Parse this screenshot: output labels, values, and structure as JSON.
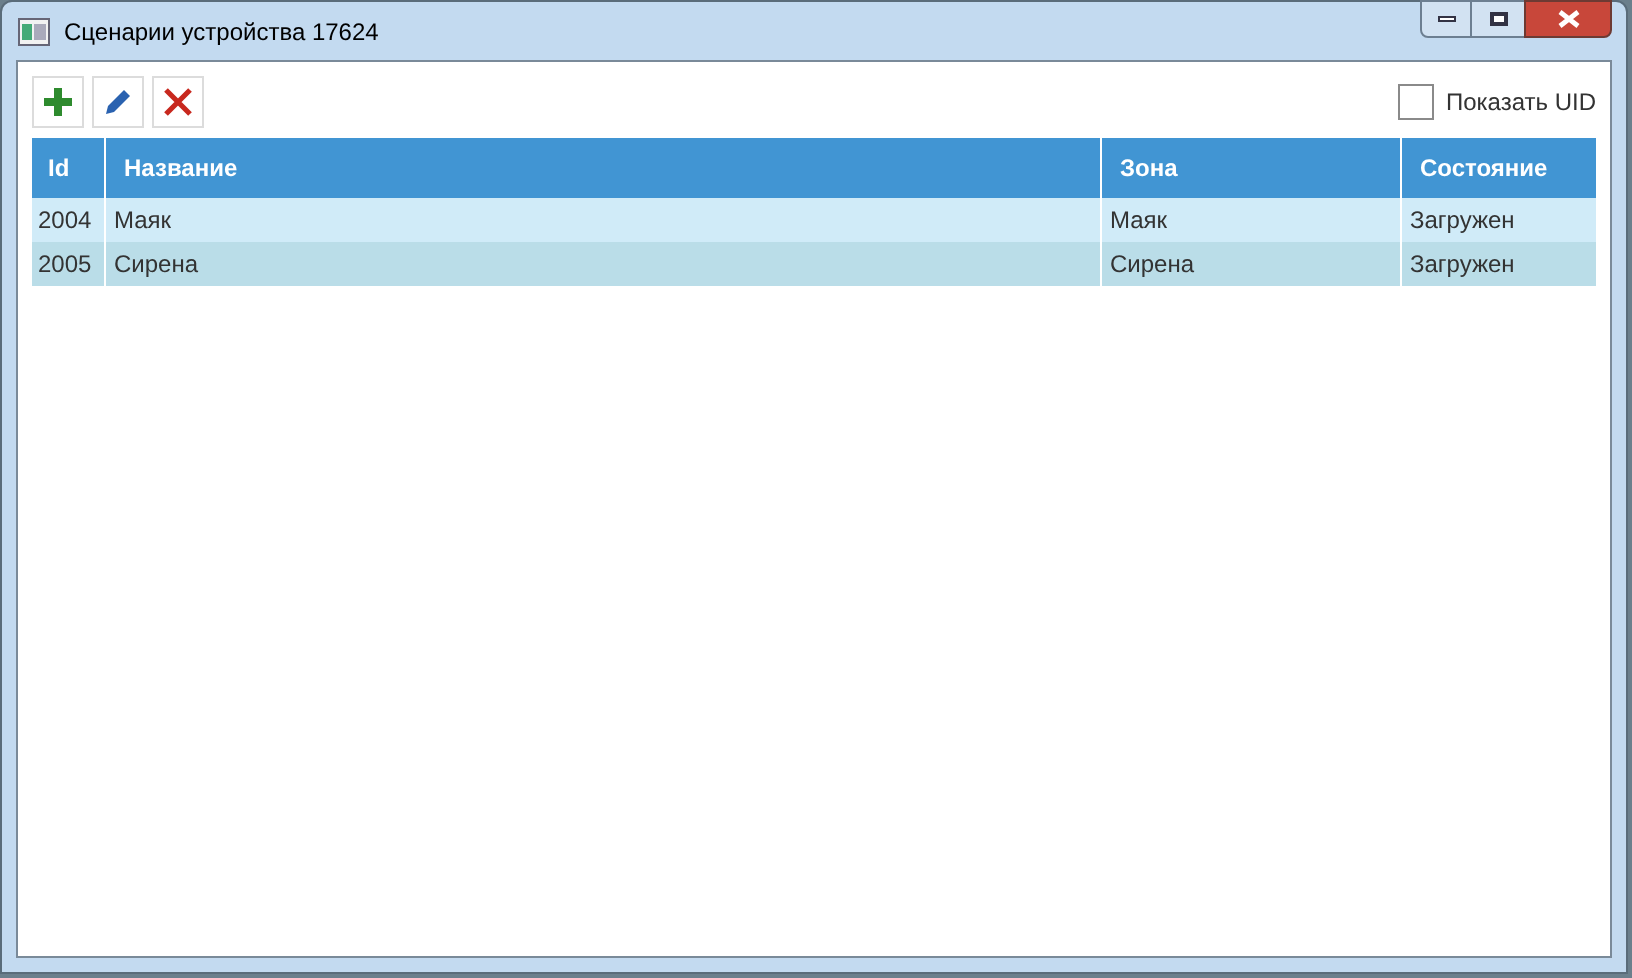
{
  "window": {
    "title": "Сценарии устройства 17624"
  },
  "toolbar": {
    "show_uid": {
      "label": "Показать UID",
      "checked": false
    }
  },
  "table": {
    "columns": [
      "Id",
      "Название",
      "Зона",
      "Состояние"
    ],
    "rows": [
      {
        "cells": [
          "2004",
          "Маяк",
          "Маяк",
          "Загружен"
        ]
      },
      {
        "cells": [
          "2005",
          "Сирена",
          "Сирена",
          "Загружен"
        ]
      }
    ]
  }
}
